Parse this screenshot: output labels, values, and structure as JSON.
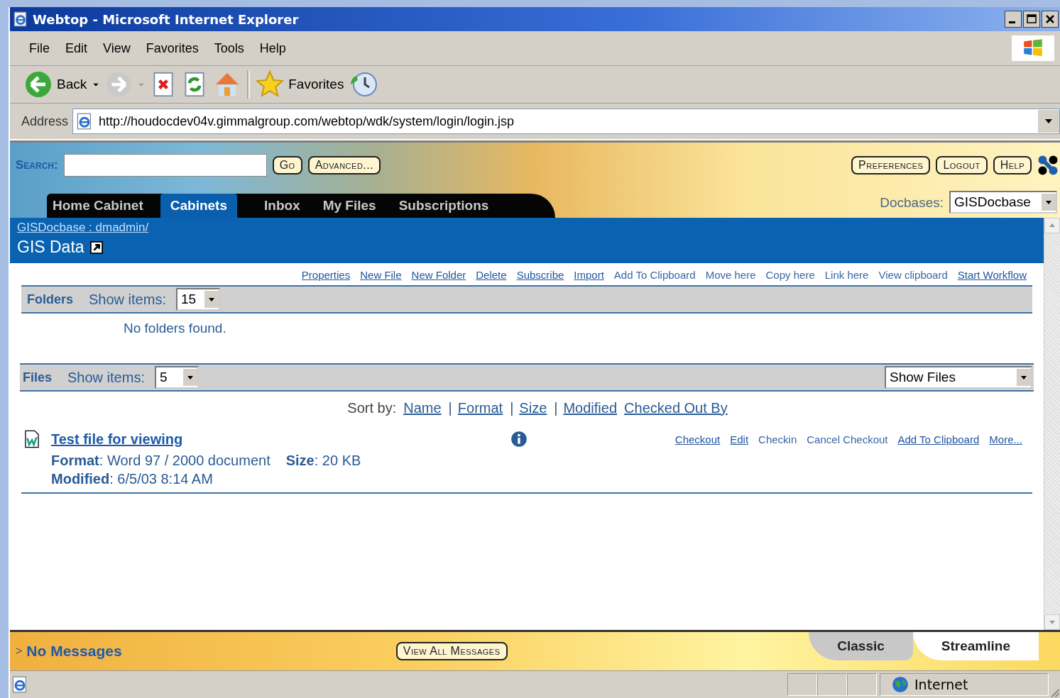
{
  "window": {
    "title": "Webtop - Microsoft Internet Explorer"
  },
  "menu": [
    "File",
    "Edit",
    "View",
    "Favorites",
    "Tools",
    "Help"
  ],
  "toolbar": {
    "back_label": "Back",
    "favorites_label": "Favorites"
  },
  "address": {
    "label": "Address",
    "url": "http://houdocdev04v.gimmalgroup.com/webtop/wdk/system/login/login.jsp"
  },
  "search": {
    "label": "Search:",
    "go": "Go",
    "advanced": "Advanced..."
  },
  "header_buttons": [
    "Preferences",
    "Logout",
    "Help"
  ],
  "tabs": [
    {
      "label": "Home Cabinet",
      "selected": false
    },
    {
      "label": "Cabinets",
      "selected": true
    },
    {
      "label": "Inbox",
      "selected": false
    },
    {
      "label": "My Files",
      "selected": false
    },
    {
      "label": "Subscriptions",
      "selected": false
    }
  ],
  "docbases": {
    "label": "Docbases:",
    "value": "GISDocbase"
  },
  "breadcrumb": "GISDocbase : dmadmin/",
  "folder_title": "GIS Data",
  "actions": [
    {
      "label": "Properties",
      "disabled": false
    },
    {
      "label": "New File",
      "disabled": false
    },
    {
      "label": "New Folder",
      "disabled": false
    },
    {
      "label": "Delete",
      "disabled": false
    },
    {
      "label": "Subscribe",
      "disabled": false
    },
    {
      "label": "Import",
      "disabled": false
    },
    {
      "label": "Add To Clipboard",
      "disabled": true
    },
    {
      "label": "Move here",
      "disabled": true
    },
    {
      "label": "Copy here",
      "disabled": true
    },
    {
      "label": "Link here",
      "disabled": true
    },
    {
      "label": "View clipboard",
      "disabled": true
    },
    {
      "label": "Start Workflow",
      "disabled": false
    }
  ],
  "folders": {
    "title": "Folders",
    "show_label": "Show items:",
    "show_value": "15",
    "empty": "No folders found."
  },
  "files": {
    "title": "Files",
    "show_label": "Show items:",
    "show_value": "5",
    "filter": "Show Files"
  },
  "sort": {
    "label": "Sort by:",
    "items": [
      {
        "kind": "link",
        "text": "Name"
      },
      {
        "kind": "separator",
        "text": "|"
      },
      {
        "kind": "link",
        "text": "Format"
      },
      {
        "kind": "separator",
        "text": "|"
      },
      {
        "kind": "link",
        "text": "Size"
      },
      {
        "kind": "separator",
        "text": "|"
      },
      {
        "kind": "link",
        "text": "Modified"
      },
      {
        "kind": "link",
        "text": "Checked Out By"
      }
    ]
  },
  "file_rows": [
    {
      "name": "Test file for viewing",
      "details": [
        "**Format**:  Word 97 / 2000 document",
        "**Size**:  20 KB"
      ],
      "modified": "**Modified**:  6/5/03 8:14 AM",
      "actions": [
        {
          "label": "Checkout",
          "disabled": false
        },
        {
          "label": "Edit",
          "disabled": false
        },
        {
          "label": "Checkin",
          "disabled": true
        },
        {
          "label": "Cancel Checkout",
          "disabled": true
        },
        {
          "label": "Add To Clipboard",
          "disabled": false
        },
        {
          "label": "More...",
          "disabled": false
        }
      ]
    }
  ],
  "messages": {
    "prefix": ">",
    "text": "No Messages",
    "button": "View All Messages"
  },
  "modes": [
    {
      "label": "Classic",
      "selected": false
    },
    {
      "label": "Streamline",
      "selected": true
    }
  ],
  "status_bar": {
    "zone": "Internet"
  }
}
